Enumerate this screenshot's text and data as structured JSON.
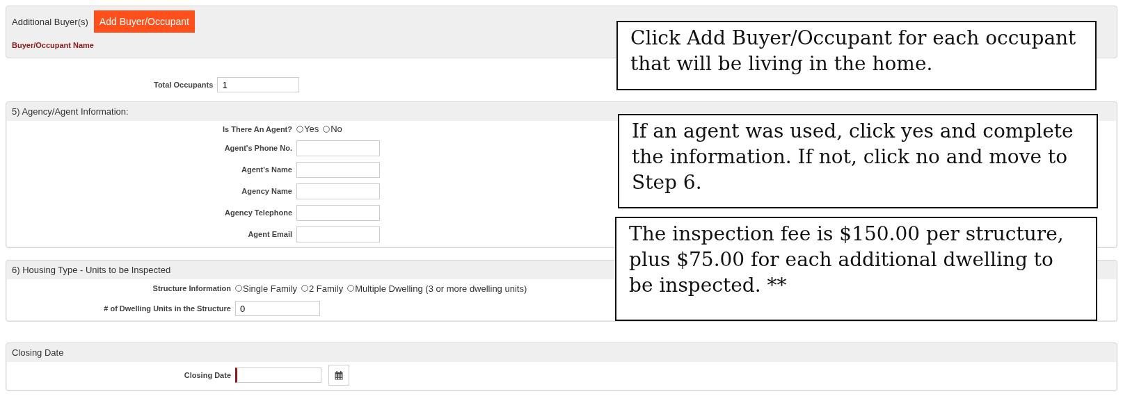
{
  "buyers": {
    "label": "Additional Buyer(s)",
    "add_button": "Add Buyer/Occupant",
    "column": "Buyer/Occupant Name"
  },
  "total_occupants": {
    "label": "Total Occupants",
    "value": "1"
  },
  "agent_section": {
    "title": "5) Agency/Agent Information:",
    "question": "Is There An Agent?",
    "options": [
      {
        "label": "Yes",
        "selected": false
      },
      {
        "label": "No",
        "selected": false
      }
    ],
    "fields": [
      {
        "label": "Agent's Phone No."
      },
      {
        "label": "Agent's Name"
      },
      {
        "label": "Agency Name"
      },
      {
        "label": "Agency Telephone"
      },
      {
        "label": "Agent Email"
      }
    ]
  },
  "housing_section": {
    "title": "6) Housing Type - Units to be Inspected",
    "question": "Structure Information",
    "options": [
      {
        "label": "Single Family",
        "selected": false
      },
      {
        "label": "2 Family",
        "selected": false
      },
      {
        "label": "Multiple Dwelling (3 or more dwelling units)",
        "selected": false
      }
    ],
    "units": {
      "label": "# of Dwelling Units in the Structure",
      "value": "0"
    }
  },
  "closing_section": {
    "title": "Closing Date",
    "label": "Closing Date",
    "required": true
  },
  "callouts": [
    {
      "text": "Click Add Buyer/Occupant for each occupant that will be living in the home."
    },
    {
      "text": "If an agent was used, click yes and complete the information. If not, click no and move to Step 6."
    },
    {
      "text": "The inspection fee is $150.00 per structure, plus $75.00 for each additional dwelling to be inspected. **"
    }
  ]
}
